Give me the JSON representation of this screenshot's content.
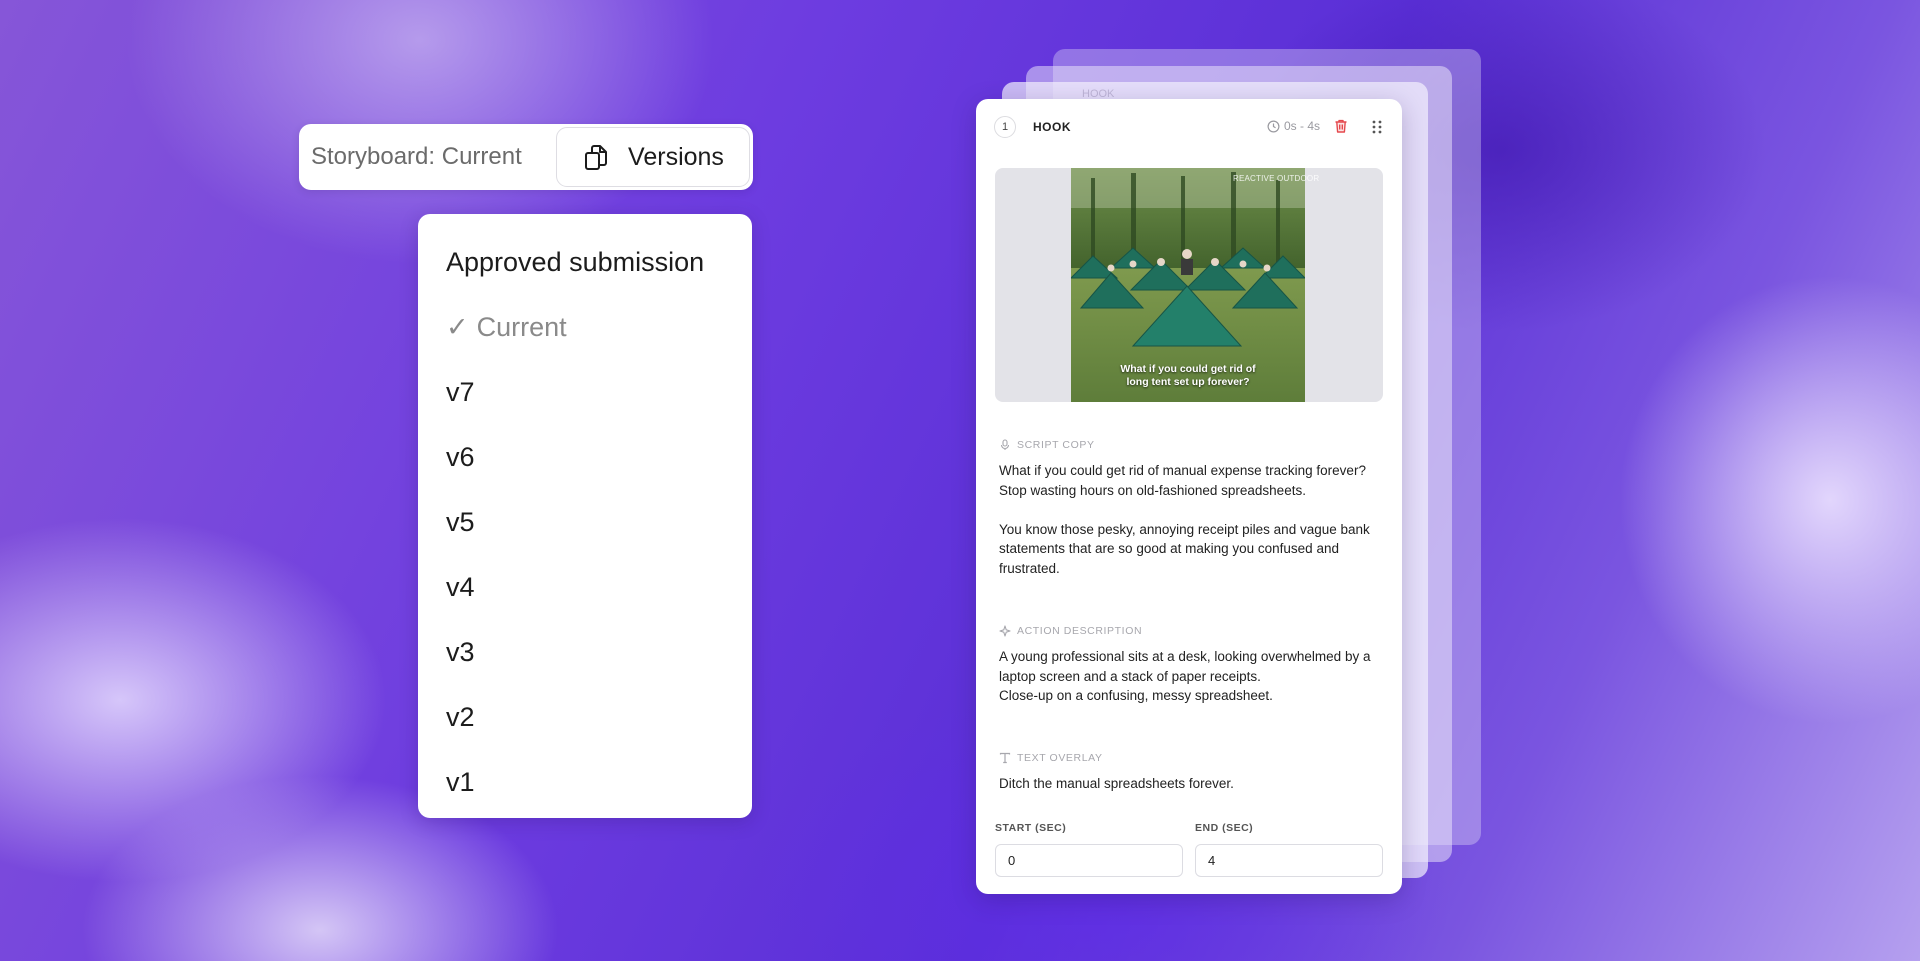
{
  "storyboard": {
    "label": "Storyboard: Current",
    "versions_button": "Versions"
  },
  "versions_menu": {
    "items": [
      {
        "label": "Approved submission"
      },
      {
        "label": "Current",
        "selected": true,
        "check": "✓"
      },
      {
        "label": "v7"
      },
      {
        "label": "v6"
      },
      {
        "label": "v5"
      },
      {
        "label": "v4"
      },
      {
        "label": "v3"
      },
      {
        "label": "v2"
      },
      {
        "label": "v1"
      }
    ]
  },
  "back_card": {
    "title": "HOOK"
  },
  "card": {
    "number": "1",
    "title": "HOOK",
    "time": "0s - 4s",
    "media": {
      "watermark": "REACTIVE OUTDOOR",
      "caption": "What if you could get rid of\nlong tent set up forever?"
    },
    "script_copy": {
      "label": "SCRIPT COPY",
      "text": "What if you could get rid of manual expense tracking forever? Stop wasting hours on old-fashioned spreadsheets.\n\nYou know those pesky, annoying receipt piles and vague bank statements that are so good at making you confused and frustrated."
    },
    "action_description": {
      "label": "ACTION DESCRIPTION",
      "text": "A young professional sits at a desk, looking overwhelmed by a laptop screen and a stack of paper receipts.\nClose-up on a confusing, messy spreadsheet."
    },
    "text_overlay": {
      "label": "TEXT OVERLAY",
      "text": "Ditch the manual spreadsheets forever."
    },
    "start": {
      "label": "START (SEC)",
      "value": "0"
    },
    "end": {
      "label": "END (SEC)",
      "value": "4"
    }
  },
  "colors": {
    "accent_purple": "#6d3ce0",
    "delete_red": "#e5484d"
  }
}
